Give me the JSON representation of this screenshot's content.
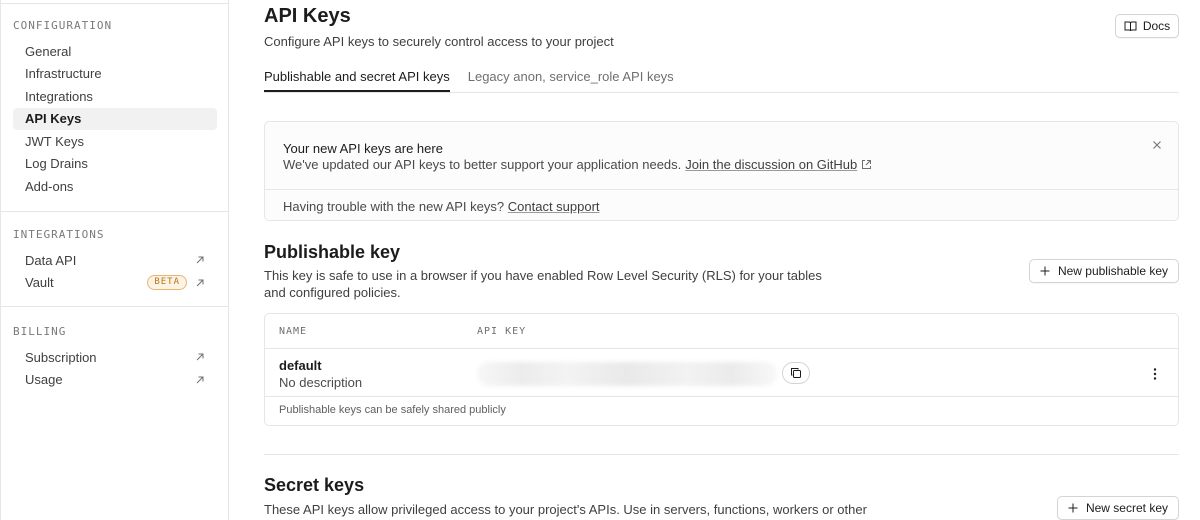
{
  "sidebar": {
    "sections": [
      {
        "heading": "CONFIGURATION",
        "items": [
          {
            "label": "General"
          },
          {
            "label": "Infrastructure"
          },
          {
            "label": "Integrations"
          },
          {
            "label": "API Keys",
            "active": true
          },
          {
            "label": "JWT Keys"
          },
          {
            "label": "Log Drains"
          },
          {
            "label": "Add-ons"
          }
        ]
      },
      {
        "heading": "INTEGRATIONS",
        "items": [
          {
            "label": "Data API",
            "external": true
          },
          {
            "label": "Vault",
            "badge": "BETA",
            "external": true
          }
        ]
      },
      {
        "heading": "BILLING",
        "items": [
          {
            "label": "Subscription",
            "external": true
          },
          {
            "label": "Usage",
            "external": true
          }
        ]
      }
    ]
  },
  "header": {
    "title": "API Keys",
    "subtitle": "Configure API keys to securely control access to your project",
    "docs_label": "Docs",
    "docs_icon": "book-icon"
  },
  "tabs": [
    {
      "label": "Publishable and secret API keys",
      "active": true
    },
    {
      "label": "Legacy anon, service_role API keys",
      "active": false
    }
  ],
  "notice": {
    "title": "Your new API keys are here",
    "text": "We've updated our API keys to better support your application needs.",
    "link": "Join the discussion on GitHub",
    "footer_text": "Having trouble with the new API keys?",
    "footer_link": "Contact support"
  },
  "publishable": {
    "title": "Publishable key",
    "description": "This key is safe to use in a browser if you have enabled Row Level Security (RLS) for your tables and configured policies.",
    "new_button": "New publishable key",
    "columns": [
      "NAME",
      "API KEY"
    ],
    "row": {
      "name": "default",
      "description": "No description"
    },
    "footer": "Publishable keys can be safely shared publicly"
  },
  "secret": {
    "title": "Secret keys",
    "description": "These API keys allow privileged access to your project's APIs. Use in servers, functions, workers or other",
    "new_button": "New secret key"
  },
  "colors": {
    "text": "#1c1c1c",
    "border": "#e6e6e6",
    "badge": "#b8741a"
  }
}
